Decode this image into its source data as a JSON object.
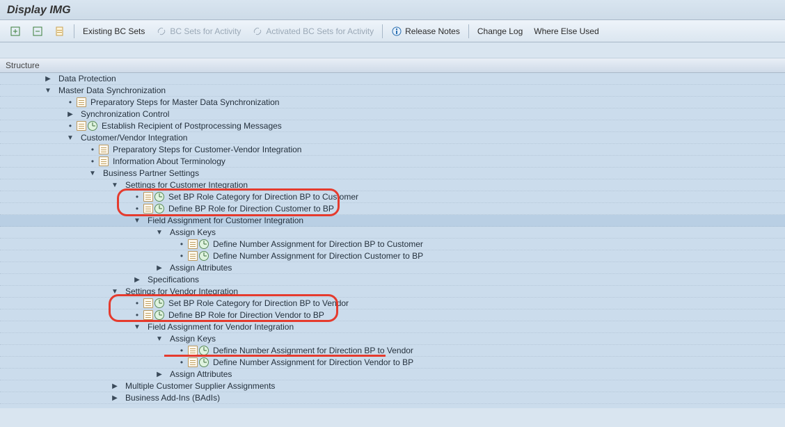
{
  "title": "Display IMG",
  "toolbar": {
    "existing_bc": "Existing BC Sets",
    "bc_for_activity": "BC Sets for Activity",
    "activated_bc": "Activated BC Sets for Activity",
    "release_notes": "Release Notes",
    "change_log": "Change Log",
    "where_else": "Where Else Used"
  },
  "structure_header": "Structure",
  "rows": [
    {
      "indent": 1,
      "exp": "right",
      "text": "Data Protection"
    },
    {
      "indent": 1,
      "exp": "down",
      "text": "Master Data Synchronization"
    },
    {
      "indent": 2,
      "leaf": true,
      "docicon": true,
      "text": "Preparatory Steps for Master Data Synchronization"
    },
    {
      "indent": 2,
      "exp": "right",
      "text": "Synchronization Control"
    },
    {
      "indent": 2,
      "leaf": true,
      "docicon": true,
      "clockicon": true,
      "text": "Establish Recipient of Postprocessing Messages"
    },
    {
      "indent": 2,
      "exp": "down",
      "text": "Customer/Vendor Integration"
    },
    {
      "indent": 3,
      "leaf": true,
      "docicon": true,
      "text": "Preparatory Steps for Customer-Vendor Integration"
    },
    {
      "indent": 3,
      "leaf": true,
      "docicon": true,
      "text": "Information About Terminology"
    },
    {
      "indent": 3,
      "exp": "down",
      "text": "Business Partner Settings"
    },
    {
      "indent": 4,
      "exp": "down",
      "text": "Settings for Customer Integration"
    },
    {
      "indent": 5,
      "leaf": true,
      "docicon": true,
      "clockicon": true,
      "text": "Set BP Role Category for Direction BP to Customer"
    },
    {
      "indent": 5,
      "leaf": true,
      "docicon": true,
      "clockicon": true,
      "text": "Define BP Role for Direction Customer to BP"
    },
    {
      "indent": 5,
      "exp": "down",
      "sel": true,
      "text": "Field Assignment for Customer Integration"
    },
    {
      "indent": 6,
      "exp": "down",
      "text": "Assign Keys"
    },
    {
      "indent": 7,
      "leaf": true,
      "docicon": true,
      "clockicon": true,
      "text": "Define Number Assignment for Direction BP to Customer"
    },
    {
      "indent": 7,
      "leaf": true,
      "docicon": true,
      "clockicon": true,
      "text": "Define Number Assignment for Direction Customer to BP"
    },
    {
      "indent": 6,
      "exp": "right",
      "text": "Assign Attributes"
    },
    {
      "indent": 5,
      "exp": "right",
      "text": "Specifications"
    },
    {
      "indent": 4,
      "exp": "down",
      "text": "Settings for Vendor Integration"
    },
    {
      "indent": 5,
      "leaf": true,
      "docicon": true,
      "clockicon": true,
      "text": "Set BP Role Category for Direction BP to Vendor"
    },
    {
      "indent": 5,
      "leaf": true,
      "docicon": true,
      "clockicon": true,
      "text": "Define BP Role for Direction Vendor to BP"
    },
    {
      "indent": 5,
      "exp": "down",
      "text": "Field Assignment for Vendor Integration"
    },
    {
      "indent": 6,
      "exp": "down",
      "text": "Assign Keys"
    },
    {
      "indent": 7,
      "leaf": true,
      "docicon": true,
      "clockicon": true,
      "text": "Define Number Assignment for Direction BP to Vendor"
    },
    {
      "indent": 7,
      "leaf": true,
      "docicon": true,
      "clockicon": true,
      "text": "Define Number Assignment for Direction Vendor to BP"
    },
    {
      "indent": 6,
      "exp": "right",
      "text": "Assign Attributes"
    },
    {
      "indent": 4,
      "exp": "right",
      "text": "Multiple Customer Supplier Assignments"
    },
    {
      "indent": 4,
      "exp": "right",
      "text": "Business Add-Ins (BAdIs)"
    }
  ]
}
